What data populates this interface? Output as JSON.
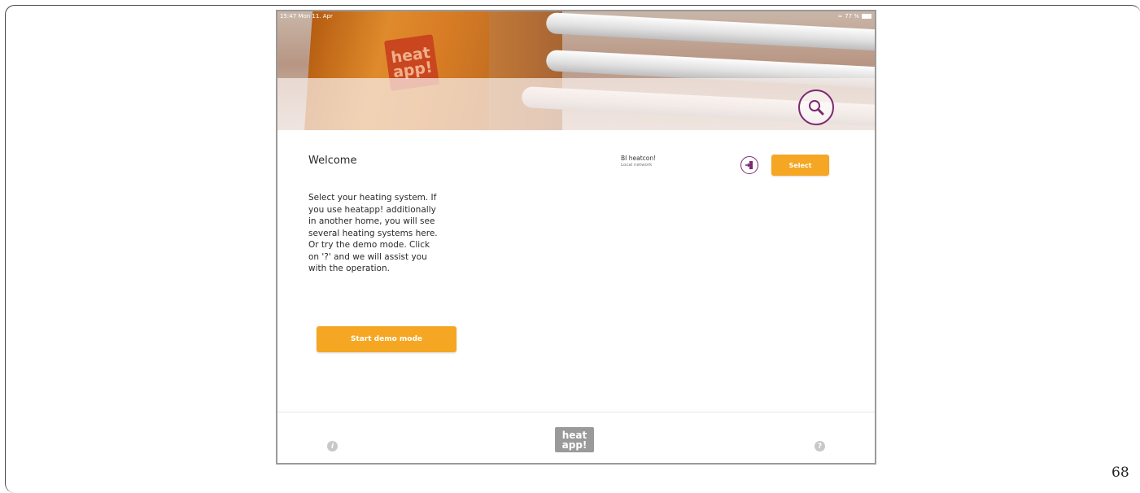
{
  "page": {
    "number": "68"
  },
  "status_bar": {
    "time": "15:47  Mon 11. Apr",
    "battery": "77 %"
  },
  "brand": {
    "logo_line1": "heat",
    "logo_line2": "app!"
  },
  "welcome": {
    "title": "Welcome",
    "description": "Select your heating system. If\nyou use heatapp! additionally\nin another home, you will see\nseveral heating systems here.\nOr try the demo mode. Click\non '?' and we will assist you\nwith the operation."
  },
  "system": {
    "name": "BI heatcon!",
    "network": "Local network"
  },
  "buttons": {
    "select": "Select",
    "demo": "Start demo mode"
  },
  "footer": {
    "info_glyph": "i",
    "help_glyph": "?"
  },
  "icons": {
    "search": "search-icon",
    "login": "login-icon",
    "info": "info-icon",
    "help": "help-icon"
  },
  "colors": {
    "accent_orange": "#f5a623",
    "accent_purple": "#7b2a70"
  }
}
